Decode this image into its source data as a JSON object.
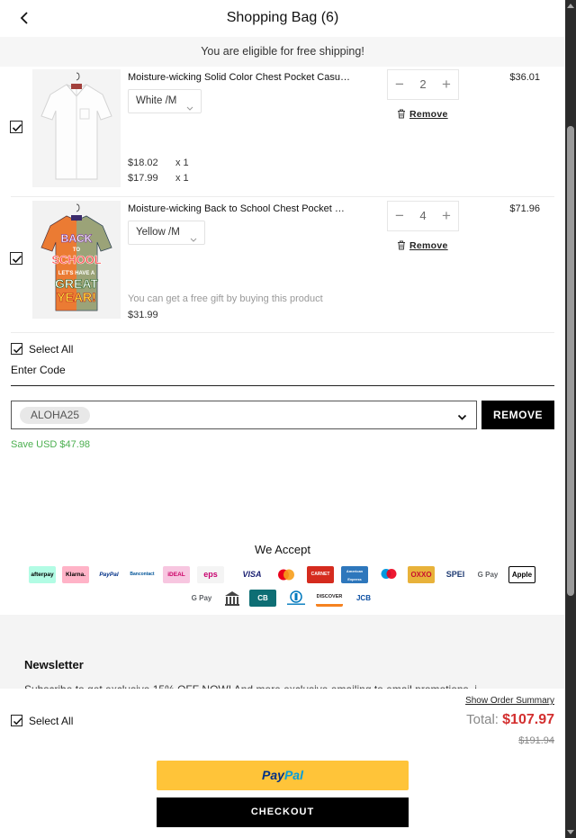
{
  "header": {
    "title": "Shopping Bag (6)"
  },
  "shipping_notice": "You are eligible for free shipping!",
  "items": [
    {
      "name": "Moisture-wicking Solid Color Chest Pocket Casual...",
      "variant": "White /M",
      "quantity": "2",
      "line_total": "$36.01",
      "prices": [
        {
          "price": "$18.02",
          "qty": "x 1"
        },
        {
          "price": "$17.99",
          "qty": "x 1"
        }
      ],
      "remove_label": "Remove",
      "checked": true,
      "shirt_color": "#f2f2f2"
    },
    {
      "name": "Moisture-wicking Back to School Chest Pocket Ca...",
      "variant": "Yellow /M",
      "quantity": "4",
      "line_total": "$71.96",
      "gift_note": "You can get a free gift by buying this product",
      "price": "$31.99",
      "remove_label": "Remove",
      "checked": true,
      "shirt_texts": [
        "BACK",
        "TO",
        "SCHOOL",
        "LET'S HAVE A",
        "GREAT",
        "YEAR!"
      ]
    }
  ],
  "select_all_label": "Select All",
  "promo": {
    "heading": "Enter Code",
    "code": "ALOHA25",
    "remove_label": "REMOVE",
    "savings": "Save USD $47.98"
  },
  "accept": {
    "title": "We Accept",
    "methods": [
      "afterpay",
      "Klarna.",
      "PayPal",
      "Bancontact",
      "iDEAL",
      "eps",
      "VISA",
      "Mastercard",
      "CARNET",
      "American Express",
      "Maestro",
      "OXXO",
      "SPEI",
      "G Pay",
      "Apple Pay",
      "G Pay",
      "Bank",
      "CB",
      "Diners Club",
      "DISCOVER",
      "JCB"
    ]
  },
  "newsletter": {
    "title": "Newsletter",
    "text": "Subscribe to get exclusive 15% OFF NOW! And more exclusive emailing to email promotions, i"
  },
  "summary": {
    "select_all_label": "Select All",
    "show_summary_label": "Show Order Summary",
    "total_label": "Total:",
    "total": "$107.97",
    "original_total": "$191.94",
    "paypal_a": "Pay",
    "paypal_b": "Pal",
    "checkout_label": "CHECKOUT"
  },
  "colors": {
    "accent_red": "#d32f2f",
    "save_green": "#4caf50",
    "paypal_yellow": "#ffc439"
  }
}
